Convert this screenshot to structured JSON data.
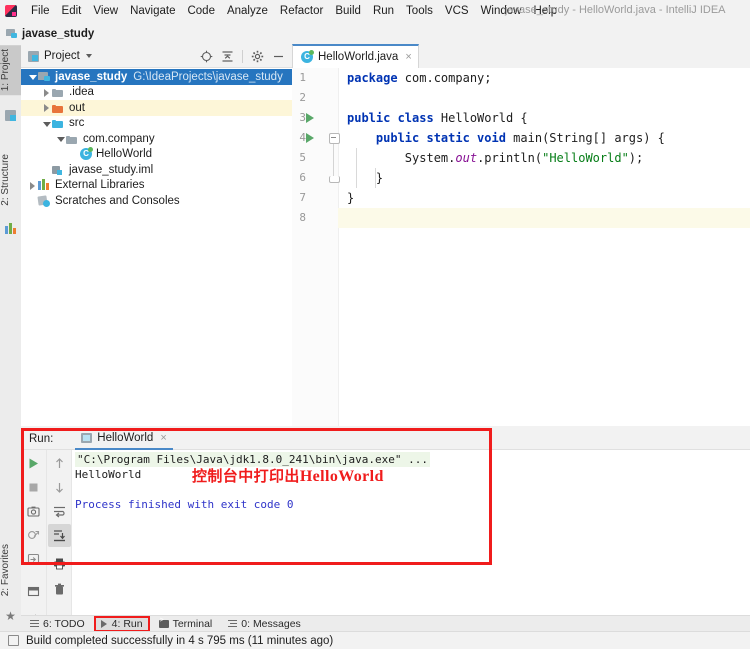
{
  "window": {
    "title": "javase_study - HelloWorld.java - IntelliJ IDEA",
    "app_icon": "intellij-idea-icon"
  },
  "menubar": {
    "items": [
      {
        "label": "File"
      },
      {
        "label": "Edit"
      },
      {
        "label": "View"
      },
      {
        "label": "Navigate"
      },
      {
        "label": "Code"
      },
      {
        "label": "Analyze"
      },
      {
        "label": "Refactor"
      },
      {
        "label": "Build"
      },
      {
        "label": "Run"
      },
      {
        "label": "Tools"
      },
      {
        "label": "VCS"
      },
      {
        "label": "Window"
      },
      {
        "label": "Help"
      }
    ]
  },
  "navbar": {
    "crumb": "javase_study",
    "icon": "module-icon"
  },
  "left_strip": {
    "tabs": [
      {
        "label": "1: Project",
        "icon": "project-icon",
        "selected": true
      },
      {
        "label": "2: Structure",
        "icon": "structure-icon",
        "selected": false
      },
      {
        "label": "2: Favorites",
        "icon": "star-icon",
        "selected": false
      }
    ]
  },
  "project_panel": {
    "title": "Project",
    "tools": [
      {
        "name": "locate-icon"
      },
      {
        "name": "collapse-all-icon"
      },
      {
        "name": "gear-icon"
      },
      {
        "name": "minimize-icon"
      }
    ],
    "tree": [
      {
        "label": "javase_study",
        "path": "G:\\IdeaProjects\\javase_study",
        "icon": "module-icon",
        "indent": 0,
        "arrow": "open",
        "state": "selected",
        "bold": true
      },
      {
        "label": ".idea",
        "path": "",
        "icon": "folder-icon",
        "indent": 1,
        "arrow": "closed",
        "state": "",
        "bold": false
      },
      {
        "label": "out",
        "path": "",
        "icon": "folder-orange-icon",
        "indent": 1,
        "arrow": "closed",
        "state": "highlight",
        "bold": false
      },
      {
        "label": "src",
        "path": "",
        "icon": "folder-blue-icon",
        "indent": 1,
        "arrow": "open",
        "state": "",
        "bold": false
      },
      {
        "label": "com.company",
        "path": "",
        "icon": "package-icon",
        "indent": 2,
        "arrow": "open",
        "state": "",
        "bold": false
      },
      {
        "label": "HelloWorld",
        "path": "",
        "icon": "java-class-icon",
        "indent": 3,
        "arrow": "none",
        "state": "",
        "bold": false
      },
      {
        "label": "javase_study.iml",
        "path": "",
        "icon": "iml-file-icon",
        "indent": 1,
        "arrow": "none",
        "state": "",
        "bold": false
      },
      {
        "label": "External Libraries",
        "path": "",
        "icon": "libraries-icon",
        "indent": 0,
        "arrow": "closed",
        "state": "",
        "bold": false
      },
      {
        "label": "Scratches and Consoles",
        "path": "",
        "icon": "scratches-icon",
        "indent": 0,
        "arrow": "none",
        "state": "",
        "bold": false
      }
    ]
  },
  "editor": {
    "tab": {
      "label": "HelloWorld.java",
      "icon": "java-class-icon",
      "close": "×"
    },
    "line_numbers": [
      "1",
      "2",
      "3",
      "4",
      "5",
      "6",
      "7",
      "8"
    ],
    "current_line": 8,
    "run_markers": [
      3,
      4
    ],
    "code": [
      {
        "n": 1,
        "tokens": [
          {
            "t": "package",
            "c": "kw"
          },
          {
            "t": " com.company;",
            "c": ""
          }
        ]
      },
      {
        "n": 2,
        "tokens": []
      },
      {
        "n": 3,
        "tokens": [
          {
            "t": "public class",
            "c": "kw"
          },
          {
            "t": " HelloWorld {",
            "c": ""
          }
        ]
      },
      {
        "n": 4,
        "tokens": [
          {
            "t": "    ",
            "c": ""
          },
          {
            "t": "public static void",
            "c": "kw"
          },
          {
            "t": " main(String[] args) {",
            "c": ""
          }
        ]
      },
      {
        "n": 5,
        "tokens": [
          {
            "t": "        System.",
            "c": ""
          },
          {
            "t": "out",
            "c": "stat"
          },
          {
            "t": ".println(",
            "c": ""
          },
          {
            "t": "\"HelloWorld\"",
            "c": "str"
          },
          {
            "t": ");",
            "c": ""
          }
        ]
      },
      {
        "n": 6,
        "tokens": [
          {
            "t": "    }",
            "c": ""
          }
        ]
      },
      {
        "n": 7,
        "tokens": [
          {
            "t": "}",
            "c": ""
          }
        ]
      },
      {
        "n": 8,
        "tokens": []
      }
    ]
  },
  "run_panel": {
    "label": "Run:",
    "tab": {
      "label": "HelloWorld",
      "icon": "run-config-icon",
      "close": "×"
    },
    "toolbar_left": [
      {
        "name": "rerun-icon"
      },
      {
        "name": "stop-icon"
      },
      {
        "name": "camera-icon"
      },
      {
        "name": "rerun-failed-icon"
      },
      {
        "name": "export-icon"
      },
      {
        "name": "layout-icon"
      },
      {
        "name": "pin-icon"
      }
    ],
    "toolbar_right": [
      {
        "name": "up-arrow-icon"
      },
      {
        "name": "down-arrow-icon"
      },
      {
        "name": "soft-wrap-icon"
      },
      {
        "name": "scroll-to-end-icon",
        "active": true
      },
      {
        "name": "print-icon"
      },
      {
        "name": "trash-icon"
      }
    ],
    "console": {
      "command": "\"C:\\Program Files\\Java\\jdk1.8.0_241\\bin\\java.exe\" ...",
      "output": "HelloWorld",
      "finished": "Process finished with exit code 0"
    }
  },
  "annotation": {
    "text_cn": "控制台中打印出",
    "text_en": "HelloWorld",
    "color": "#f01c1c",
    "box_color": "#f01c1c"
  },
  "bottom_bar": {
    "items": [
      {
        "label": "6: TODO",
        "icon": "todo-icon",
        "selected": false
      },
      {
        "label": "4: Run",
        "icon": "run-icon",
        "selected": true
      },
      {
        "label": "Terminal",
        "icon": "terminal-icon",
        "selected": false
      },
      {
        "label": "0: Messages",
        "icon": "messages-icon",
        "selected": false
      }
    ]
  },
  "status_bar": {
    "icon": "build-icon",
    "text": "Build completed successfully in 4 s 795 ms (11 minutes ago)"
  },
  "colors": {
    "accent_blue": "#2675bf",
    "tab_underline": "#4a89c8",
    "annotation_red": "#f01c1c",
    "run_green": "#59a869",
    "keyword_blue": "#0033b3",
    "string_green": "#067d17",
    "static_purple": "#871094",
    "console_blue": "#2f34c9"
  }
}
